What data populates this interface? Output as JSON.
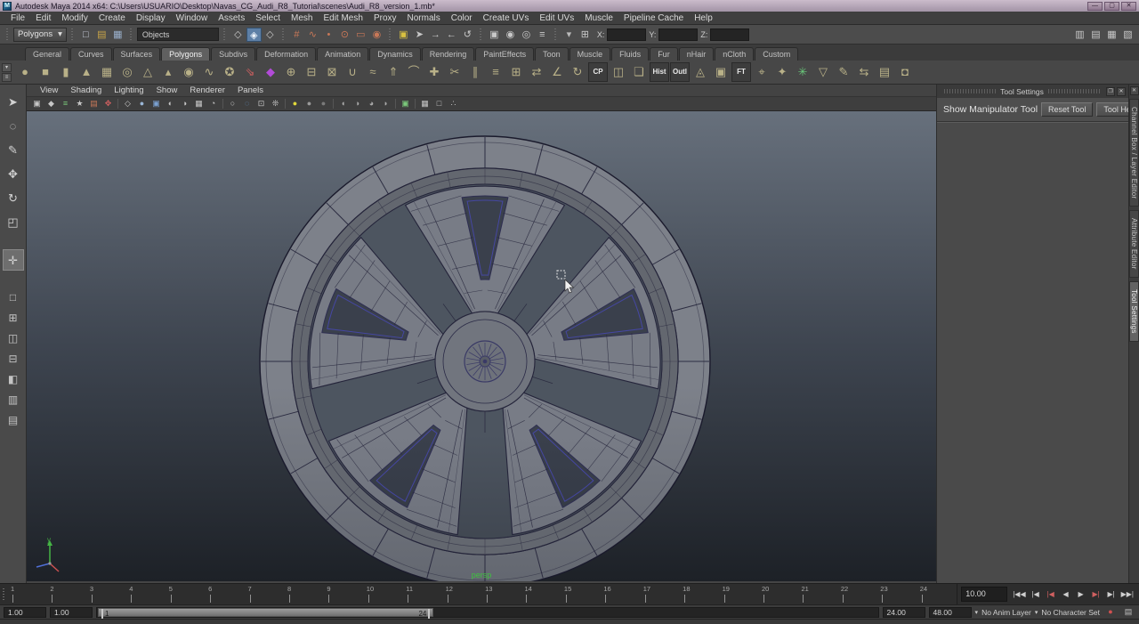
{
  "window": {
    "title": "Autodesk Maya 2014 x64: C:\\Users\\USUARIO\\Desktop\\Navas_CG_Audi_R8_Tutorial\\scenes\\Audi_R8_version_1.mb*",
    "minimize": "—",
    "restore": "▢",
    "close": "✕",
    "logo": "M"
  },
  "menubar": {
    "items": [
      "File",
      "Edit",
      "Modify",
      "Create",
      "Display",
      "Window",
      "Assets",
      "Select",
      "Mesh",
      "Edit Mesh",
      "Proxy",
      "Normals",
      "Color",
      "Create UVs",
      "Edit UVs",
      "Muscle",
      "Pipeline Cache",
      "Help"
    ]
  },
  "statusline": {
    "menuset": "Polygons",
    "objects": "Objects",
    "coords": {
      "x_label": "X:",
      "y_label": "Y:",
      "z_label": "Z:",
      "x": "",
      "y": "",
      "z": ""
    },
    "file_icons": [
      {
        "n": "new-scene-icon",
        "g": "□",
        "c": "#cdd4e0"
      },
      {
        "n": "open-scene-icon",
        "g": "▤",
        "c": "#c8a448"
      },
      {
        "n": "save-scene-icon",
        "g": "▦",
        "c": "#9ab0cc"
      }
    ],
    "mask_icons": [
      {
        "n": "select-hierarchy-icon",
        "g": "◇",
        "c": "#c8c8c8"
      },
      {
        "n": "select-object-icon",
        "g": "◈",
        "cls": "hl"
      },
      {
        "n": "select-component-icon",
        "g": "◇",
        "c": "#c8c8c8"
      }
    ],
    "snap_icons": [
      {
        "n": "snap-grid-icon",
        "g": "#",
        "c": "#c87858"
      },
      {
        "n": "snap-curve-icon",
        "g": "∿",
        "c": "#c87858"
      },
      {
        "n": "snap-point-icon",
        "g": "•",
        "c": "#c87858"
      },
      {
        "n": "snap-projected-center-icon",
        "g": "⊙",
        "c": "#c87858"
      },
      {
        "n": "snap-view-plane-icon",
        "g": "▭",
        "c": "#c87858"
      },
      {
        "n": "make-live-icon",
        "g": "◉",
        "c": "#c87858"
      }
    ],
    "history_icons": [
      {
        "n": "lock-selection-icon",
        "g": "▣",
        "c": "#d8c040"
      },
      {
        "n": "highlight-selection-icon",
        "g": "➤",
        "c": "#c8c8c8"
      },
      {
        "n": "input-connections-icon",
        "g": "→",
        "c": "#c8c8c8"
      },
      {
        "n": "output-connections-icon",
        "g": "←",
        "c": "#c8c8c8"
      },
      {
        "n": "construction-history-icon",
        "g": "↺",
        "c": "#c8c8c8"
      }
    ],
    "render_icons": [
      {
        "n": "render-view-icon",
        "g": "▣",
        "c": "#c8c8c8"
      },
      {
        "n": "render-current-frame-icon",
        "g": "◉",
        "c": "#c8c8c8"
      },
      {
        "n": "ipr-render-icon",
        "g": "◎",
        "c": "#c8c8c8"
      },
      {
        "n": "render-settings-icon",
        "g": "≡",
        "c": "#c8c8c8"
      }
    ],
    "entry_icons": [
      {
        "n": "field-entry-caret-icon",
        "g": "▾",
        "c": "#bababa"
      },
      {
        "n": "quick-selection-field-icon",
        "g": "⊞",
        "c": "#c8c8c8"
      }
    ],
    "sidebar_icons": [
      {
        "n": "toggle-attribute-editor-icon",
        "g": "▥",
        "c": "#c8c8c8"
      },
      {
        "n": "toggle-tool-settings-icon",
        "g": "▤",
        "c": "#c8c8c8"
      },
      {
        "n": "toggle-channel-box-icon",
        "g": "▦",
        "c": "#c8c8c8"
      },
      {
        "n": "toggle-modeling-toolkit-icon",
        "g": "▧",
        "c": "#c8c8c8"
      }
    ]
  },
  "shelf": {
    "tabs": [
      {
        "label": "General"
      },
      {
        "label": "Curves"
      },
      {
        "label": "Surfaces"
      },
      {
        "label": "Polygons",
        "cls": "active"
      },
      {
        "label": "Subdivs"
      },
      {
        "label": "Deformation"
      },
      {
        "label": "Animation"
      },
      {
        "label": "Dynamics"
      },
      {
        "label": "Rendering"
      },
      {
        "label": "PaintEffects"
      },
      {
        "label": "Toon"
      },
      {
        "label": "Muscle"
      },
      {
        "label": "Fluids"
      },
      {
        "label": "Fur"
      },
      {
        "label": "nHair"
      },
      {
        "label": "nCloth"
      },
      {
        "label": "Custom"
      }
    ],
    "icons": [
      {
        "n": "poly-sphere-icon",
        "g": "●"
      },
      {
        "n": "poly-cube-icon",
        "g": "■"
      },
      {
        "n": "poly-cylinder-icon",
        "g": "▮"
      },
      {
        "n": "poly-cone-icon",
        "g": "▲"
      },
      {
        "n": "poly-plane-icon",
        "g": "▦"
      },
      {
        "n": "poly-torus-icon",
        "g": "◎"
      },
      {
        "n": "poly-prism-icon",
        "g": "△"
      },
      {
        "n": "poly-pyramid-icon",
        "g": "▴"
      },
      {
        "n": "poly-pipe-icon",
        "g": "◉"
      },
      {
        "n": "poly-helix-icon",
        "g": "∿"
      },
      {
        "n": "poly-soccerball-icon",
        "g": "✪"
      },
      {
        "n": "sculpt-geometry-icon",
        "g": "⇘",
        "c": "#d06060"
      },
      {
        "n": "poly-platonic-solid-icon",
        "g": "◆",
        "c": "#b24bd8"
      },
      {
        "n": "combine-icon",
        "g": "⊕"
      },
      {
        "n": "separate-icon",
        "g": "⊟"
      },
      {
        "n": "extract-icon",
        "g": "⊠"
      },
      {
        "n": "boolean-union-icon",
        "g": "∪"
      },
      {
        "n": "smooth-icon",
        "g": "≈"
      },
      {
        "n": "extrude-icon",
        "g": "⇑"
      },
      {
        "n": "bridge-icon",
        "g": "⌒"
      },
      {
        "n": "append-polygon-icon",
        "g": "✚"
      },
      {
        "n": "cut-faces-icon",
        "g": "✂"
      },
      {
        "n": "insert-edge-loop-icon",
        "g": "∥"
      },
      {
        "n": "offset-edge-loop-icon",
        "g": "≡"
      },
      {
        "n": "add-divisions-icon",
        "g": "⊞"
      },
      {
        "n": "slide-edge-icon",
        "g": "⇄"
      },
      {
        "n": "crease-tool-icon",
        "g": "∠"
      },
      {
        "n": "spin-edge-icon",
        "g": "↻"
      },
      {
        "n": "close-border-icon",
        "t": "CP"
      },
      {
        "n": "mirror-geometry-icon",
        "g": "◫"
      },
      {
        "n": "duplicate-icon",
        "g": "❏"
      },
      {
        "n": "delete-history-icon",
        "t": "Hist"
      },
      {
        "n": "outliner-icon",
        "t": "Outl"
      },
      {
        "n": "triangulate-icon",
        "g": "◬"
      },
      {
        "n": "quadrangulate-icon",
        "g": "▣"
      },
      {
        "n": "freeze-transform-icon",
        "t": "FT"
      },
      {
        "n": "center-pivot-icon",
        "g": "⌖"
      },
      {
        "n": "cleanup-icon",
        "g": "✦"
      },
      {
        "n": "normals-icon",
        "g": "✳",
        "c": "#6ac87a"
      },
      {
        "n": "reduce-icon",
        "g": "▽"
      },
      {
        "n": "paint-weights-icon",
        "g": "✎"
      },
      {
        "n": "transfer-attributes-icon",
        "g": "⇆"
      },
      {
        "n": "uv-snapshot-icon",
        "g": "▤"
      },
      {
        "n": "assign-material-icon",
        "g": "◘"
      }
    ]
  },
  "toolbox": {
    "tools": [
      {
        "n": "select-tool-icon",
        "g": "➤"
      },
      {
        "n": "lasso-select-tool-icon",
        "g": "◌"
      },
      {
        "n": "paint-selection-tool-icon",
        "g": "✎"
      },
      {
        "n": "move-tool-icon",
        "g": "✥"
      },
      {
        "n": "rotate-tool-icon",
        "g": "↻"
      },
      {
        "n": "scale-tool-icon",
        "g": "◰"
      },
      {
        "n": "spacer",
        "cls": "gap",
        "g": "",
        "i": "false"
      },
      {
        "n": "show-manipulator-tool-icon",
        "g": "✛",
        "cls": "cur"
      },
      {
        "n": "spacer",
        "cls": "gap",
        "g": "",
        "i": "false"
      },
      {
        "n": "single-pane-layout-icon",
        "g": "□",
        "cls": "layout"
      },
      {
        "n": "four-pane-layout-icon",
        "g": "⊞",
        "cls": "layout"
      },
      {
        "n": "two-pane-side-layout-icon",
        "g": "◫",
        "cls": "layout"
      },
      {
        "n": "two-pane-stacked-layout-icon",
        "g": "⊟",
        "cls": "layout"
      },
      {
        "n": "three-pane-split-layout-icon",
        "g": "◧",
        "cls": "layout"
      },
      {
        "n": "outliner-persp-layout-icon",
        "g": "▥",
        "cls": "layout"
      },
      {
        "n": "hypershade-persp-layout-icon",
        "g": "▤",
        "cls": "layout"
      }
    ]
  },
  "viewport": {
    "panel_menus": [
      "View",
      "Shading",
      "Lighting",
      "Show",
      "Renderer",
      "Panels"
    ],
    "camera_label": "persp",
    "toolbar_icons": [
      {
        "n": "select-camera-icon",
        "g": "▣"
      },
      {
        "n": "lock-camera-icon",
        "g": "◆"
      },
      {
        "n": "camera-attributes-icon",
        "g": "≡",
        "c": "#7ac87a"
      },
      {
        "n": "bookmark-icon",
        "g": "★"
      },
      {
        "n": "image-plane-icon",
        "g": "▤",
        "c": "#c87858"
      },
      {
        "n": "pan-zoom-icon",
        "g": "✥",
        "c": "#d06060"
      },
      {
        "sep": true
      },
      {
        "n": "wireframe-mode-icon",
        "g": "◇"
      },
      {
        "n": "smooth-shade-mode-icon",
        "g": "●",
        "c": "#9ab6d6"
      },
      {
        "n": "textured-mode-icon",
        "g": "▣",
        "c": "#7aa0d0"
      },
      {
        "n": "use-all-lights-icon",
        "g": "◐"
      },
      {
        "n": "shadows-icon",
        "g": "◑"
      },
      {
        "n": "screen-ao-icon",
        "g": "▦"
      },
      {
        "n": "motion-blur-icon",
        "g": "◔"
      },
      {
        "sep": true
      },
      {
        "n": "default-material-icon",
        "g": "○"
      },
      {
        "n": "xray-icon",
        "g": "◌",
        "c": "#6aa0d8"
      },
      {
        "n": "isolate-select-icon",
        "g": "⊡"
      },
      {
        "n": "multisample-icon",
        "g": "❊"
      },
      {
        "sep": true
      },
      {
        "n": "lighting-all-icon",
        "g": "●",
        "c": "#e0d83a"
      },
      {
        "n": "lighting-selected-icon",
        "g": "●",
        "c": "#9a9a9a"
      },
      {
        "n": "lighting-flat-icon",
        "g": "●",
        "c": "#7a7a7a"
      },
      {
        "sep": true
      },
      {
        "n": "shading-ball-1-icon",
        "g": "◖",
        "c": "#aaaaaa"
      },
      {
        "n": "shading-ball-2-icon",
        "g": "◑",
        "c": "#aaaaaa"
      },
      {
        "n": "shading-ball-3-icon",
        "g": "◕",
        "c": "#aaaaaa"
      },
      {
        "n": "shading-ball-4-icon",
        "g": "◗",
        "c": "#aaaaaa"
      },
      {
        "sep": true
      },
      {
        "n": "object-details-icon",
        "g": "▣",
        "c": "#7ac87a"
      },
      {
        "sep": true
      },
      {
        "n": "grid-toggle-icon",
        "g": "▦"
      },
      {
        "n": "film-gate-icon",
        "g": "□"
      },
      {
        "n": "hud-toggle-icon",
        "g": "∴"
      }
    ]
  },
  "tool_settings": {
    "title": "Tool Settings",
    "tool_name": "Show Manipulator Tool",
    "reset": "Reset Tool",
    "help": "Tool Help",
    "pin": "❐",
    "close": "✕"
  },
  "side_tabs": [
    {
      "label": "Channel Box / Layer Editor"
    },
    {
      "label": "Attribute Editor"
    },
    {
      "label": "Tool Settings",
      "cls": "active"
    }
  ],
  "timeline": {
    "frames": [
      1,
      2,
      3,
      4,
      5,
      6,
      7,
      8,
      9,
      10,
      11,
      12,
      13,
      14,
      15,
      16,
      17,
      18,
      19,
      20,
      21,
      22,
      23,
      24
    ],
    "current_time": "10.00",
    "playback": [
      {
        "n": "go-to-start-button",
        "g": "|◀◀"
      },
      {
        "n": "step-back-frame-button",
        "g": "|◀"
      },
      {
        "n": "step-back-key-button",
        "g": "|◀",
        "cls": "red"
      },
      {
        "n": "play-backwards-button",
        "g": "◀"
      },
      {
        "n": "play-forwards-button",
        "g": "▶"
      },
      {
        "n": "step-forward-key-button",
        "g": "▶|",
        "cls": "red"
      },
      {
        "n": "step-forward-frame-button",
        "g": "▶|"
      },
      {
        "n": "go-to-end-button",
        "g": "▶▶|"
      }
    ]
  },
  "range": {
    "anim_start": "1.00",
    "playback_start": "1.00",
    "range_start": "1",
    "range_end": "24",
    "playback_end": "24.00",
    "anim_end": "48.00",
    "anim_layer": "No Anim Layer",
    "character_set": "No Character Set"
  },
  "colors": {
    "viewport_top": "#67707c",
    "viewport_bottom": "#1d2127",
    "wireframe": "#24243a",
    "selection_blue": "#4848b8",
    "camera_label_green": "#3ec43e"
  }
}
